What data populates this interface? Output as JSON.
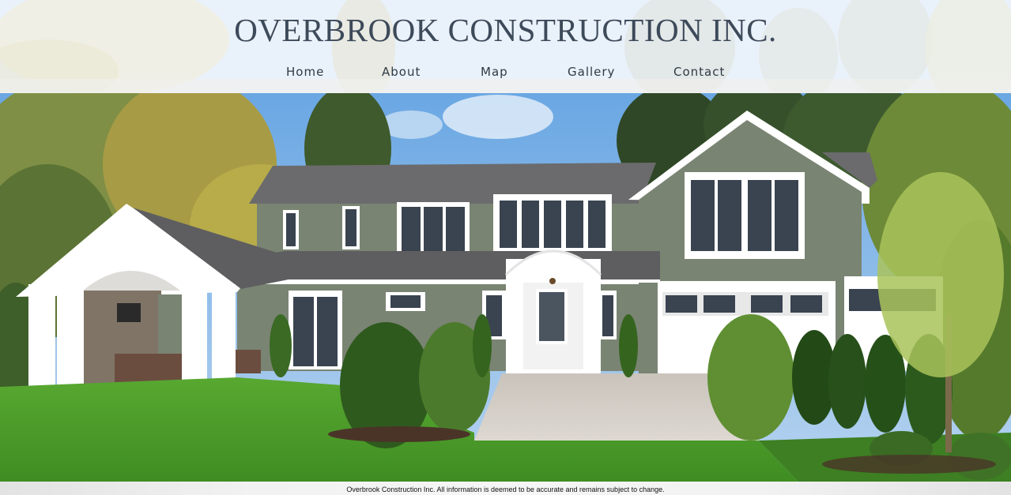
{
  "site": {
    "title": "OVERBROOK CONSTRUCTION INC."
  },
  "nav": {
    "items": [
      {
        "label": "Home"
      },
      {
        "label": "About"
      },
      {
        "label": "Map"
      },
      {
        "label": "Gallery"
      },
      {
        "label": "Contact"
      }
    ]
  },
  "hero": {
    "image": "house-photo"
  },
  "footer": {
    "text": "Overbrook Construction Inc. All information is deemed to be accurate and remains subject to change."
  },
  "colors": {
    "title": "#3d4a5a",
    "nav_text": "#2f3a45",
    "siding": "#7a8473",
    "trim": "#ffffff",
    "roof": "#5c5c5e",
    "lawn": "#4d9a2a",
    "sky": "#7eb3e6"
  }
}
